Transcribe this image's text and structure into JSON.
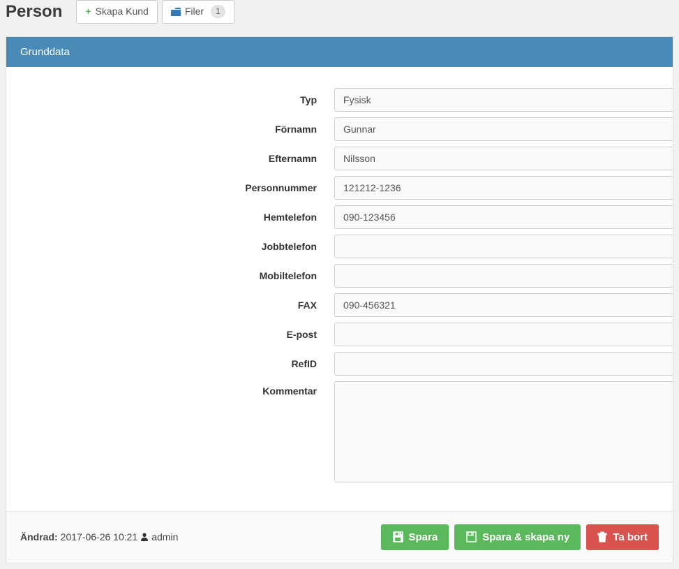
{
  "header": {
    "title": "Person",
    "create_button": "Skapa Kund",
    "files_button": "Filer",
    "files_count": "1"
  },
  "panel": {
    "title": "Grunddata"
  },
  "form": {
    "typ": {
      "label": "Typ",
      "value": "Fysisk"
    },
    "fornamn": {
      "label": "Förnamn",
      "value": "Gunnar"
    },
    "efternamn": {
      "label": "Efternamn",
      "value": "Nilsson"
    },
    "personnummer": {
      "label": "Personnummer",
      "value": "121212-1236"
    },
    "hemtelefon": {
      "label": "Hemtelefon",
      "value": "090-123456"
    },
    "jobbtelefon": {
      "label": "Jobbtelefon",
      "value": ""
    },
    "mobiltelefon": {
      "label": "Mobiltelefon",
      "value": ""
    },
    "fax": {
      "label": "FAX",
      "value": "090-456321"
    },
    "epost": {
      "label": "E-post",
      "value": ""
    },
    "refid": {
      "label": "RefID",
      "value": ""
    },
    "kommentar": {
      "label": "Kommentar",
      "value": ""
    }
  },
  "footer": {
    "changed_label": "Ändrad:",
    "changed_value": "2017-06-26 10:21",
    "user": "admin",
    "save": "Spara",
    "save_new": "Spara & skapa ny",
    "delete": "Ta bort"
  }
}
